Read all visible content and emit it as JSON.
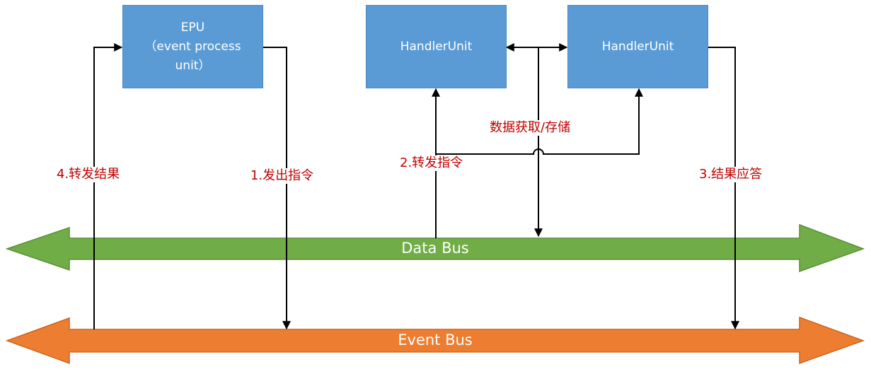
{
  "nodes": {
    "epu": {
      "line1": "EPU",
      "line2": "（event process",
      "line3": "unit）"
    },
    "handler_left": {
      "label": "HandlerUnit"
    },
    "handler_right": {
      "label": "HandlerUnit"
    }
  },
  "buses": {
    "data": {
      "label": "Data Bus",
      "color": "#70ad47"
    },
    "event": {
      "label": "Event Bus",
      "color": "#ed7d31"
    }
  },
  "edges": {
    "issue": "1.发出指令",
    "forward_cmd": "2.转发指令",
    "reply": "3.结果应答",
    "forward_result": "4.转发结果",
    "data_access": "数据获取/存储"
  },
  "colors": {
    "box_fill": "#5b9bd5",
    "label_text": "#c00000",
    "line": "#000000"
  }
}
